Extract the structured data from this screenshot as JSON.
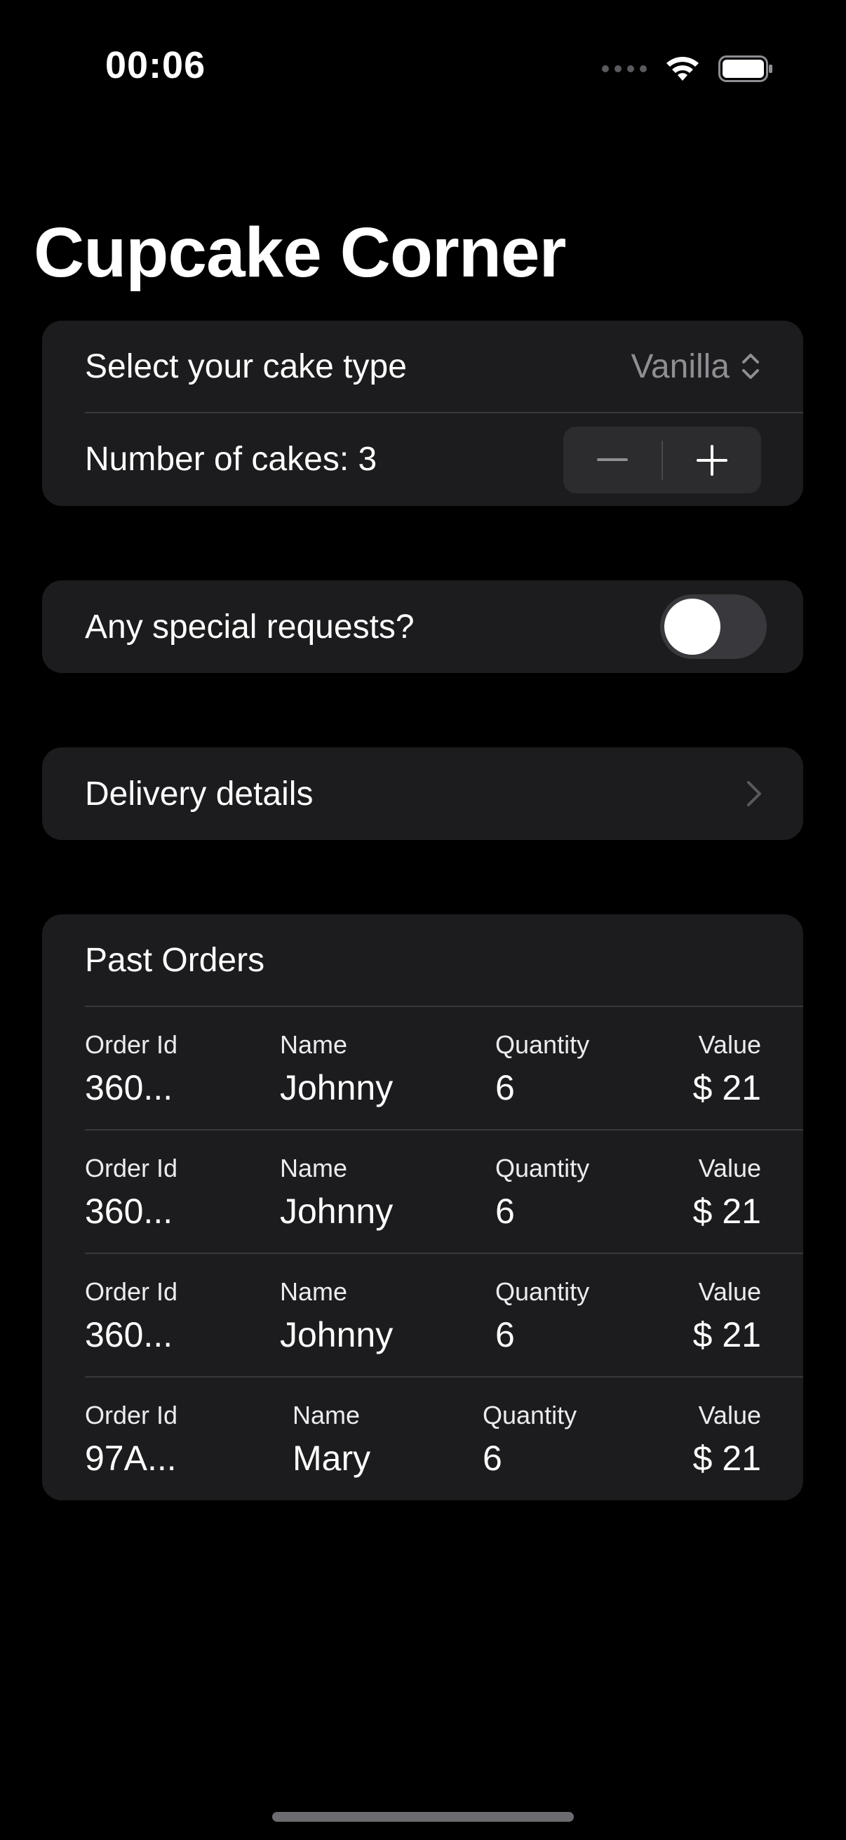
{
  "status_bar": {
    "time": "00:06",
    "icons": [
      "signal-dots-icon",
      "wifi-icon",
      "battery-icon"
    ]
  },
  "page": {
    "title": "Cupcake Corner"
  },
  "order_form": {
    "cake_type_label": "Select your cake type",
    "cake_type_value": "Vanilla",
    "number_label": "Number of cakes: 3"
  },
  "special_requests": {
    "label": "Any special requests?",
    "toggle_on": false
  },
  "delivery": {
    "label": "Delivery details"
  },
  "past_orders": {
    "title": "Past Orders",
    "columns": {
      "order_id": "Order Id",
      "name": "Name",
      "quantity": "Quantity",
      "value": "Value"
    },
    "rows": [
      {
        "order_id": "360...",
        "name": "Johnny",
        "quantity": "6",
        "value": "$ 21"
      },
      {
        "order_id": "360...",
        "name": "Johnny",
        "quantity": "6",
        "value": "$ 21"
      },
      {
        "order_id": "360...",
        "name": "Johnny",
        "quantity": "6",
        "value": "$ 21"
      },
      {
        "order_id": "97A...",
        "name": "Mary",
        "quantity": "6",
        "value": "$ 21"
      }
    ]
  },
  "colors": {
    "background": "#000000",
    "card": "#1c1c1e",
    "secondary_text": "#8e8e93",
    "separator": "#38383a"
  }
}
